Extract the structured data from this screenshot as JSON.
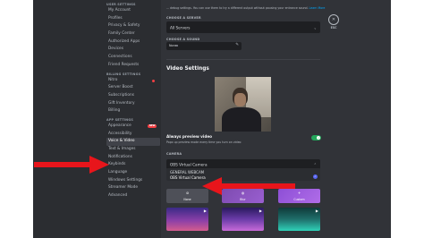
{
  "sidebar": {
    "sections": [
      {
        "heading": "USER SETTINGS",
        "items": [
          {
            "label": "My Account"
          },
          {
            "label": "Profiles"
          },
          {
            "label": "Privacy & Safety"
          },
          {
            "label": "Family Center"
          },
          {
            "label": "Authorized Apps"
          },
          {
            "label": "Devices"
          },
          {
            "label": "Connections"
          },
          {
            "label": "Friend Requests"
          }
        ]
      },
      {
        "heading": "BILLING SETTINGS",
        "items": [
          {
            "label": "Nitro"
          },
          {
            "label": "Server Boost"
          },
          {
            "label": "Subscriptions"
          },
          {
            "label": "Gift Inventory"
          },
          {
            "label": "Billing"
          }
        ]
      },
      {
        "heading": "APP SETTINGS",
        "items": [
          {
            "label": "Appearance",
            "badge": "NEW"
          },
          {
            "label": "Accessibility"
          },
          {
            "label": "Voice & Video"
          },
          {
            "label": "Text & Images"
          },
          {
            "label": "Notifications"
          },
          {
            "label": "Keybinds"
          },
          {
            "label": "Language"
          },
          {
            "label": "Windows Settings"
          },
          {
            "label": "Streamer Mode"
          },
          {
            "label": "Advanced"
          }
        ]
      }
    ]
  },
  "content": {
    "top_note": "... debug settings. You can use them to try a different output without pausing your entrance sound.",
    "top_note_link": "Learn More",
    "server_label": "CHOOSE A SERVER",
    "server_value": "All Servers",
    "sound_label": "CHOOSE A SOUND",
    "sound_value": "None",
    "close_label": "ESC",
    "video_heading": "Video Settings",
    "always_preview_title": "Always preview video",
    "always_preview_sub": "Pops up preview mode every time you turn on video",
    "camera_label": "CAMERA",
    "camera_value": "OBS Virtual Camera",
    "camera_options": [
      "GENERAL WEBCAM",
      "OBS Virtual Camera"
    ],
    "backgrounds": [
      {
        "label": "None",
        "icon": "⊘"
      },
      {
        "label": "Blur",
        "icon": "◍"
      },
      {
        "label": "Custom",
        "icon": "+"
      }
    ]
  },
  "colors": {
    "accent": "#5865f2",
    "toggle_on": "#23a55a",
    "annotation_arrow": "#e8151b",
    "sidebar_bg": "#2b2d31",
    "content_bg": "#313338"
  }
}
